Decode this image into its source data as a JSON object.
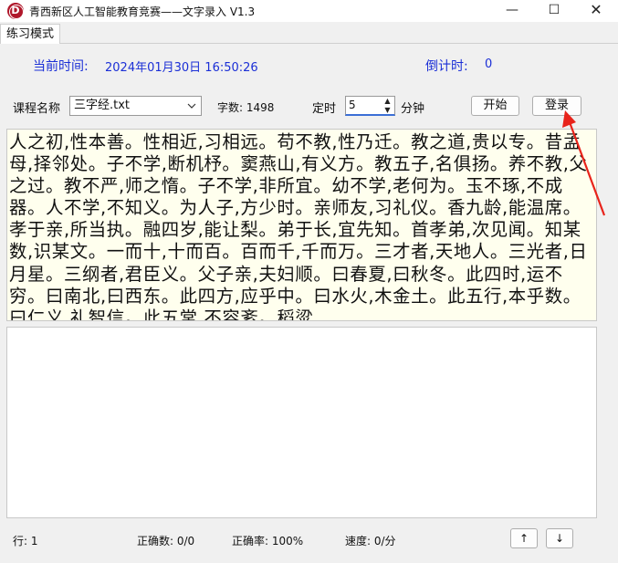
{
  "window": {
    "title": "青西新区人工智能教育竞赛——文字录入 V1.3",
    "icon_letter": "D",
    "controls": {
      "minimize": "—",
      "maximize": "☐",
      "close": "✕"
    }
  },
  "tabs": [
    {
      "label": "练习模式"
    }
  ],
  "header": {
    "current_time_label": "当前时间:",
    "current_time_value": "2024年01月30日 16:50:26",
    "countdown_label": "倒计时:",
    "countdown_value": "0"
  },
  "controls": {
    "course_label": "课程名称",
    "course_selected": "三字经.txt",
    "word_count": "字数: 1498",
    "timer_label": "定时",
    "timer_value": "5",
    "minute_label": "分钟",
    "start_label": "开始",
    "login_label": "登录"
  },
  "source_text": "人之初,性本善。性相近,习相远。苟不教,性乃迁。教之道,贵以专。昔孟母,择邻处。子不学,断机杼。窦燕山,有义方。教五子,名俱扬。养不教,父之过。教不严,师之惰。子不学,非所宜。幼不学,老何为。玉不琢,不成器。人不学,不知义。为人子,方少时。亲师友,习礼仪。香九龄,能温席。孝于亲,所当执。融四岁,能让梨。弟于长,宜先知。首孝弟,次见闻。知某数,识某文。一而十,十而百。百而千,千而万。三才者,天地人。三光者,日月星。三纲者,君臣义。父子亲,夫妇顺。曰春夏,曰秋冬。此四时,运不穷。曰南北,曰西东。此四方,应乎中。曰水火,木金土。此五行,本乎数。曰仁义,礼智信。此五常,不容紊。稻粱",
  "input_text": "",
  "status": {
    "line": "行: 1",
    "correct_count": "正确数: 0/0",
    "accuracy": "正确率: 100%",
    "speed": "速度: 0/分",
    "up_label": "↑",
    "down_label": "↓"
  },
  "colors": {
    "accent_blue": "#1b2fd6",
    "text_bg": "#ffffee",
    "annotation_red": "#e8231b"
  }
}
